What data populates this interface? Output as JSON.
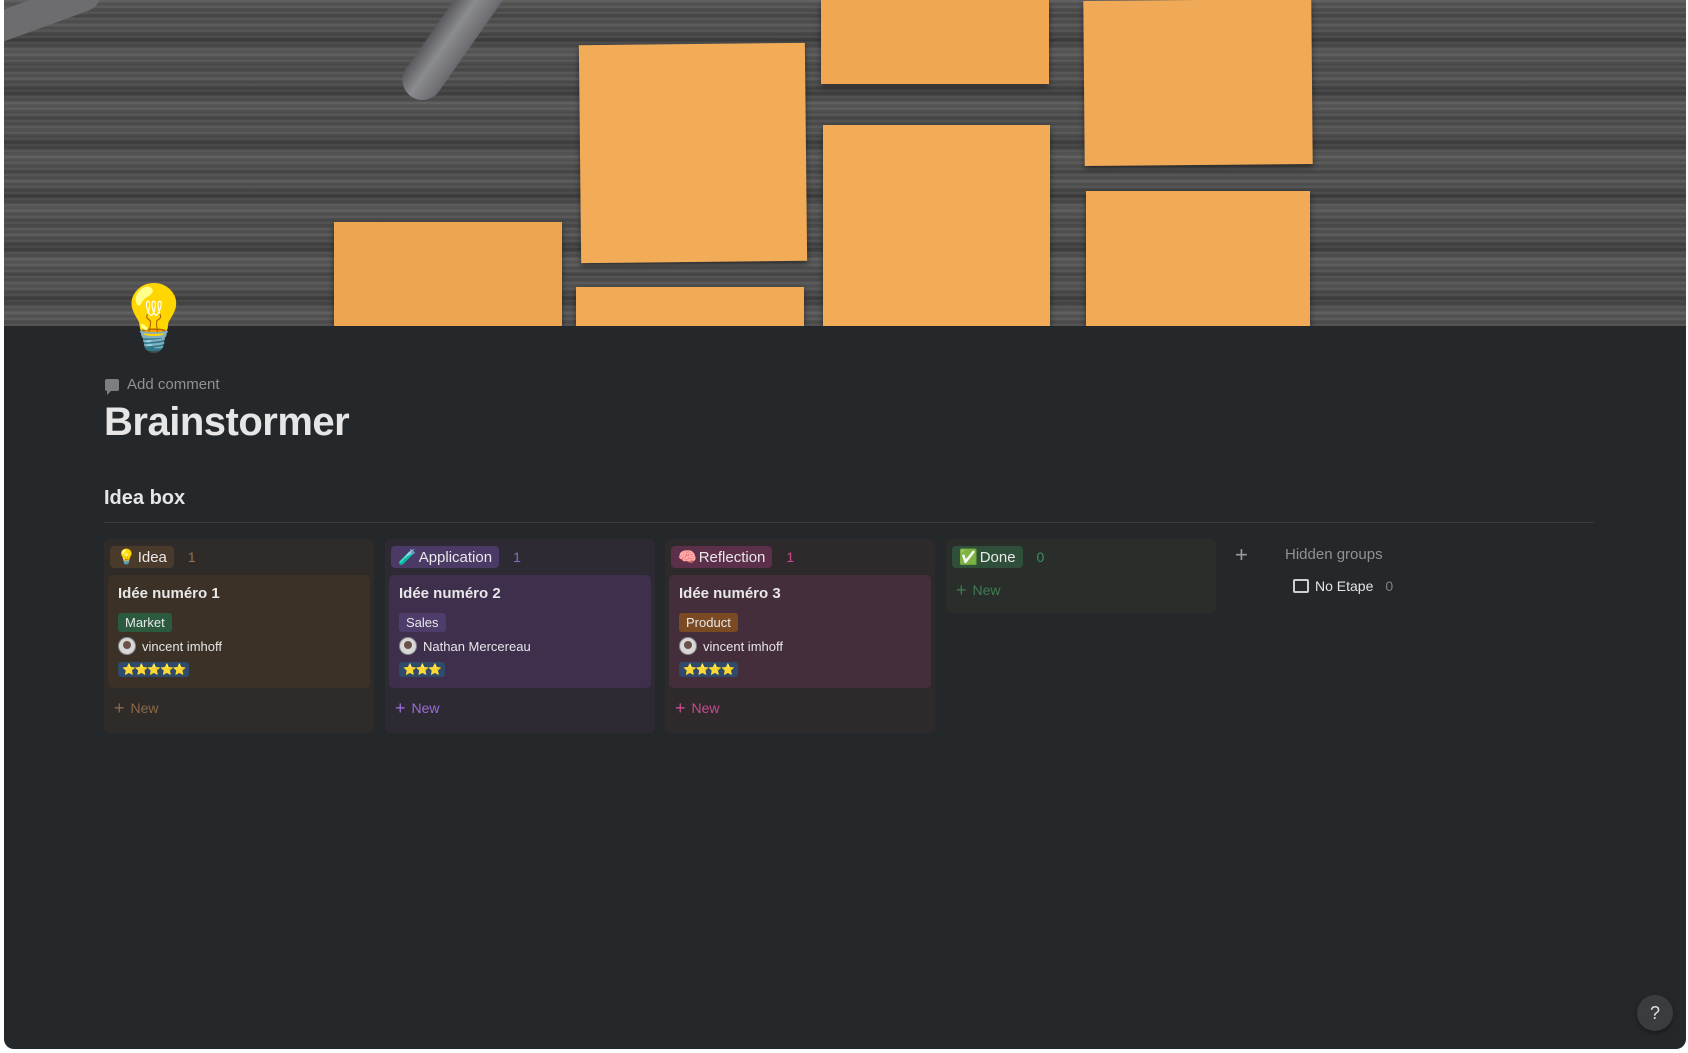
{
  "page": {
    "icon": "💡",
    "add_comment": "Add comment",
    "title": "Brainstormer"
  },
  "board": {
    "title": "Idea box",
    "new_label": "New",
    "hidden_groups_label": "Hidden groups",
    "columns": [
      {
        "emoji": "💡",
        "name": "Idea",
        "count": "1",
        "cards": [
          {
            "title": "Idée numéro 1",
            "tag": "Market",
            "person": "vincent imhoff",
            "rating": "⭐⭐⭐⭐⭐"
          }
        ]
      },
      {
        "emoji": "🧪",
        "name": "Application",
        "count": "1",
        "cards": [
          {
            "title": "Idée numéro 2",
            "tag": "Sales",
            "person": "Nathan Mercereau",
            "rating": "⭐⭐⭐"
          }
        ]
      },
      {
        "emoji": "🧠",
        "name": "Reflection",
        "count": "1",
        "cards": [
          {
            "title": "Idée numéro 3",
            "tag": "Product",
            "person": "vincent imhoff",
            "rating": "⭐⭐⭐⭐"
          }
        ]
      },
      {
        "emoji": "✅",
        "name": "Done",
        "count": "0",
        "cards": []
      }
    ],
    "hidden_groups": [
      {
        "name": "No Etape",
        "count": "0"
      }
    ]
  },
  "help": {
    "label": "?"
  },
  "colors": {
    "background": "#25282b",
    "idea_accent": "#b07c4f",
    "application_accent": "#9a6dd7",
    "reflection_accent": "#c64d8f",
    "done_accent": "#3f8f5c",
    "market_tag": "#2b5a3f",
    "sales_tag": "#4e3d6b",
    "product_tag": "#7a4a22"
  }
}
